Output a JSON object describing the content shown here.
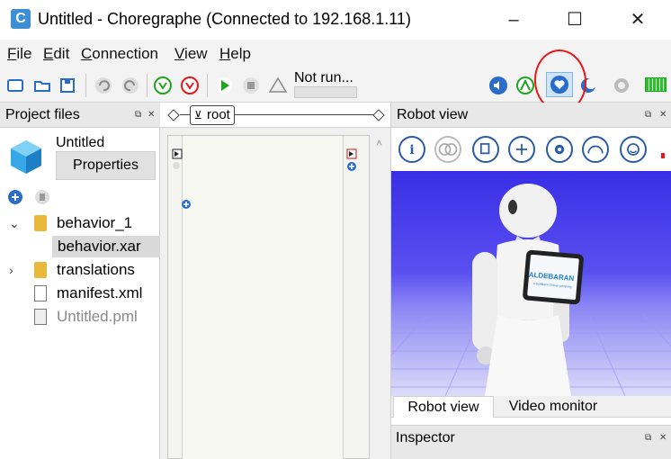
{
  "window": {
    "title": "Untitled - Choregraphe (Connected to 192.168.1.11)",
    "app_icon_letter": "C",
    "minimize": "–",
    "maximize": "☐",
    "close": "✕"
  },
  "menu": {
    "items": [
      {
        "label_first": "F",
        "label_rest": "ile"
      },
      {
        "label_first": "E",
        "label_rest": "dit"
      },
      {
        "label_first": "C",
        "label_rest": "onnection"
      },
      {
        "label_first": "V",
        "label_rest": "iew"
      },
      {
        "label_first": "H",
        "label_rest": "elp"
      }
    ]
  },
  "toolbar": {
    "status": "Not run...",
    "icons": [
      "new-file-icon",
      "open-file-icon",
      "save-icon",
      "undo-icon",
      "redo-icon",
      "connect-icon",
      "disconnect-icon",
      "play-icon",
      "stop-icon",
      "debug-icon",
      "volume-icon",
      "animation-mode-icon",
      "autonomous-life-icon",
      "rest-icon",
      "stiffness-icon",
      "battery-icon"
    ],
    "colors": {
      "accent": "#2a6cc9",
      "green": "#1fa51f",
      "red": "#e81818"
    }
  },
  "project": {
    "header": "Project files",
    "name": "Untitled",
    "properties_button": "Properties",
    "tree": [
      {
        "label": "behavior_1",
        "type": "folder",
        "expanded": true,
        "level": 0
      },
      {
        "label": "behavior.xar",
        "type": "file",
        "selected": true,
        "level": 1
      },
      {
        "label": "translations",
        "type": "folder",
        "expanded": false,
        "level": 0
      },
      {
        "label": "manifest.xml",
        "type": "file",
        "level": 0
      },
      {
        "label": "Untitled.pml",
        "type": "pml",
        "level": 0
      }
    ]
  },
  "flow": {
    "root_label": "root"
  },
  "robot_view": {
    "header": "Robot view",
    "tabs": [
      "Robot view",
      "Video monitor"
    ],
    "tablet_text": "ALDEBARAN",
    "tablet_subtext": "A SoftBank Group company"
  },
  "inspector": {
    "header": "Inspector"
  }
}
